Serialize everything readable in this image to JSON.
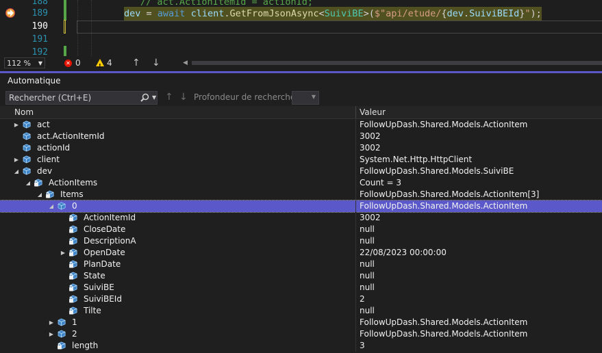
{
  "editor": {
    "lines": [
      {
        "number": "188",
        "code": "// act.ActionItemId = actionId;"
      },
      {
        "number": "189",
        "code": "dev = await client.GetFromJsonAsync<SuiviBE>($\"api/etude/{dev.SuiviBEId}\");"
      },
      {
        "number": "190",
        "code": ""
      },
      {
        "number": "191",
        "code": ""
      },
      {
        "number": "192",
        "code": ""
      }
    ],
    "tokens_189": {
      "a": "dev",
      "b": " = ",
      "c": "await",
      "d": " ",
      "e": "client",
      "f": ".",
      "g": "GetFromJsonAsync",
      "h": "<",
      "i": "SuiviBE",
      "j": ">(",
      "k": "$\"api/etude/",
      "l": "{",
      "m": "dev",
      "n": ".",
      "o": "SuiviBEId",
      "p": "}",
      "q": "\"",
      "r": ");"
    },
    "accent_highlight": "#505020",
    "next_statement_icon": "arrow-right-icon"
  },
  "status": {
    "zoom": "112 %",
    "errors": "0",
    "warnings": "4"
  },
  "autos": {
    "title": "Automatique",
    "search_placeholder": "Rechercher (Ctrl+E)",
    "depth_label": "Profondeur de recherche :",
    "col_name": "Nom",
    "col_value": "Valeur",
    "selected_color": "#5b59c9",
    "rows": [
      {
        "name": "act",
        "value": "FollowUpDash.Shared.Models.ActionItem",
        "level": 0,
        "expander": "collapsed",
        "icon": "object-icon"
      },
      {
        "name": "act.ActionItemId",
        "value": "3002",
        "level": 0,
        "expander": "none",
        "icon": "object-icon"
      },
      {
        "name": "actionId",
        "value": "3002",
        "level": 0,
        "expander": "none",
        "icon": "object-icon"
      },
      {
        "name": "client",
        "value": "System.Net.Http.HttpClient",
        "level": 0,
        "expander": "collapsed",
        "icon": "object-icon"
      },
      {
        "name": "dev",
        "value": "FollowUpDash.Shared.Models.SuiviBE",
        "level": 0,
        "expander": "expanded",
        "icon": "object-icon"
      },
      {
        "name": "ActionItems",
        "value": "Count = 3",
        "level": 1,
        "expander": "expanded",
        "icon": "private-property-icon"
      },
      {
        "name": "Items",
        "value": "FollowUpDash.Shared.Models.ActionItem[3]",
        "level": 2,
        "expander": "expanded",
        "icon": "private-property-icon"
      },
      {
        "name": "0",
        "value": "FollowUpDash.Shared.Models.ActionItem",
        "level": 3,
        "expander": "expanded",
        "icon": "object-icon",
        "selected": true
      },
      {
        "name": "ActionItemId",
        "value": "3002",
        "level": 4,
        "expander": "none",
        "icon": "private-property-icon"
      },
      {
        "name": "CloseDate",
        "value": "null",
        "level": 4,
        "expander": "none",
        "icon": "private-property-icon"
      },
      {
        "name": "DescriptionA",
        "value": "null",
        "level": 4,
        "expander": "none",
        "icon": "private-property-icon"
      },
      {
        "name": "OpenDate",
        "value": "22/08/2023 00:00:00",
        "level": 4,
        "expander": "collapsed",
        "icon": "private-property-icon"
      },
      {
        "name": "PlanDate",
        "value": "null",
        "level": 4,
        "expander": "none",
        "icon": "private-property-icon"
      },
      {
        "name": "State",
        "value": "null",
        "level": 4,
        "expander": "none",
        "icon": "private-property-icon"
      },
      {
        "name": "SuiviBE",
        "value": "null",
        "level": 4,
        "expander": "none",
        "icon": "private-property-icon"
      },
      {
        "name": "SuiviBEId",
        "value": "2",
        "level": 4,
        "expander": "none",
        "icon": "private-property-icon"
      },
      {
        "name": "Tilte",
        "value": "null",
        "level": 4,
        "expander": "none",
        "icon": "private-property-icon"
      },
      {
        "name": "1",
        "value": "FollowUpDash.Shared.Models.ActionItem",
        "level": 3,
        "expander": "collapsed",
        "icon": "object-icon"
      },
      {
        "name": "2",
        "value": "FollowUpDash.Shared.Models.ActionItem",
        "level": 3,
        "expander": "collapsed",
        "icon": "object-icon"
      },
      {
        "name": "length",
        "value": "3",
        "level": 3,
        "expander": "none",
        "icon": "private-property-icon"
      }
    ]
  }
}
